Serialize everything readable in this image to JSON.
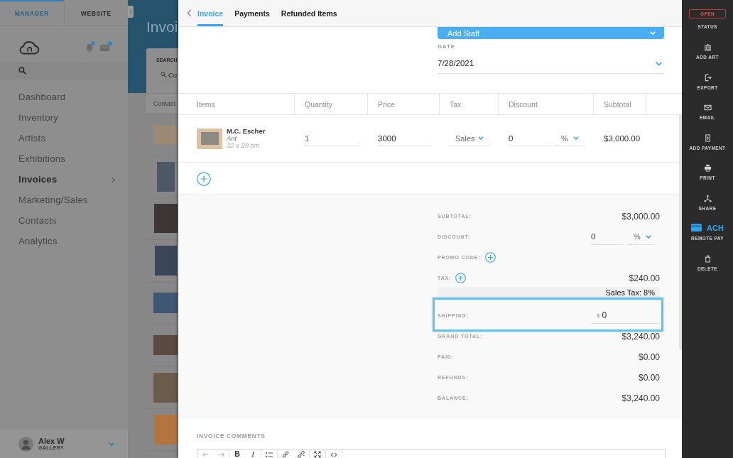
{
  "sidebar": {
    "tabs": [
      {
        "label": "MANAGER",
        "selected": true
      },
      {
        "label": "WEBSITE",
        "selected": false
      }
    ],
    "alerts": [
      {
        "kind": "bell",
        "unread": true
      },
      {
        "kind": "mail",
        "unread": true
      }
    ],
    "nav": [
      {
        "label": "Dashboard",
        "selected": false,
        "expandable": false
      },
      {
        "label": "Inventory",
        "selected": false,
        "expandable": false
      },
      {
        "label": "Artists",
        "selected": false,
        "expandable": false
      },
      {
        "label": "Exhibitions",
        "selected": false,
        "expandable": false
      },
      {
        "label": "Invoices",
        "selected": true,
        "expandable": true
      },
      {
        "label": "Marketing/Sales",
        "selected": false,
        "expandable": false
      },
      {
        "label": "Contacts",
        "selected": false,
        "expandable": false
      },
      {
        "label": "Analytics",
        "selected": false,
        "expandable": false
      }
    ],
    "user": {
      "name": "Alex W",
      "role": "GALLERY"
    }
  },
  "background_page": {
    "title": "Invoi",
    "search_label": "SEARCH",
    "search_placeholder": "Co",
    "column": "Contact"
  },
  "tabs": [
    {
      "label": "Invoice",
      "selected": true
    },
    {
      "label": "Payments",
      "selected": false
    },
    {
      "label": "Refunded Items",
      "selected": false
    }
  ],
  "staff_button": {
    "label": "Add Staff"
  },
  "date": {
    "label": "DATE",
    "value": "7/28/2021"
  },
  "table": {
    "columns": [
      "Items",
      "Quantity",
      "Price",
      "Tax",
      "Discount",
      "Subtotal"
    ],
    "rows": [
      {
        "artist": "M.C. Escher",
        "title": "Ant",
        "size": "32 x 28 cm",
        "quantity": "1",
        "price": "3000",
        "tax": "Sales",
        "discount": "0",
        "discount_unit": "%",
        "subtotal": "$3,000.00"
      }
    ]
  },
  "totals": [
    {
      "kind": "amount",
      "label": "SUBTOTAL:",
      "value": "$3,000.00"
    },
    {
      "kind": "discount",
      "label": "DISCOUNT:",
      "value": "0",
      "unit": "%"
    },
    {
      "kind": "add",
      "label": "PROMO CODE:"
    },
    {
      "kind": "tax",
      "label": "TAX:",
      "value": "$240.00",
      "note": "Sales Tax: 8%"
    },
    {
      "kind": "shipping",
      "label": "SHIPPING:",
      "prefix": "$",
      "value": "0",
      "highlighted": true
    },
    {
      "kind": "amount",
      "label": "GRAND TOTAL:",
      "value": "$3,240.00"
    },
    {
      "kind": "amount",
      "label": "PAID:",
      "value": "$0.00"
    },
    {
      "kind": "amount",
      "label": "REFUNDS:",
      "value": "$0.00"
    },
    {
      "kind": "amount",
      "label": "BALANCE:",
      "value": "$3,240.00"
    }
  ],
  "comments": {
    "label": "INVOICE COMMENTS",
    "toolbar": [
      {
        "items": [
          {
            "kind": "undo",
            "disabled": true
          },
          {
            "kind": "redo",
            "disabled": true
          }
        ]
      },
      {
        "items": [
          {
            "kind": "bold",
            "label": "B",
            "disabled": false
          },
          {
            "kind": "italic",
            "label": "I",
            "disabled": false
          }
        ]
      },
      {
        "items": [
          {
            "kind": "list",
            "disabled": false
          }
        ]
      },
      {
        "items": [
          {
            "kind": "link",
            "disabled": false
          },
          {
            "kind": "unlink",
            "disabled": false
          }
        ]
      },
      {
        "items": [
          {
            "kind": "fullscreen",
            "disabled": false
          }
        ]
      },
      {
        "items": [
          {
            "kind": "code",
            "disabled": false
          }
        ]
      }
    ]
  },
  "actions": {
    "status": {
      "label": "OPEN",
      "caption": "STATUS"
    },
    "items": [
      {
        "kind": "add_art",
        "label": "ADD ART"
      },
      {
        "kind": "export",
        "label": "EXPORT"
      },
      {
        "kind": "email",
        "label": "EMAIL"
      },
      {
        "kind": "add_payment",
        "label": "ADD PAYMENT"
      },
      {
        "kind": "print",
        "label": "PRINT"
      },
      {
        "kind": "share",
        "label": "SHARE"
      },
      {
        "kind": "remote_pay",
        "badge": "ACH",
        "label": "REMOTE PAY"
      },
      {
        "kind": "delete",
        "label": "DELETE"
      }
    ]
  }
}
